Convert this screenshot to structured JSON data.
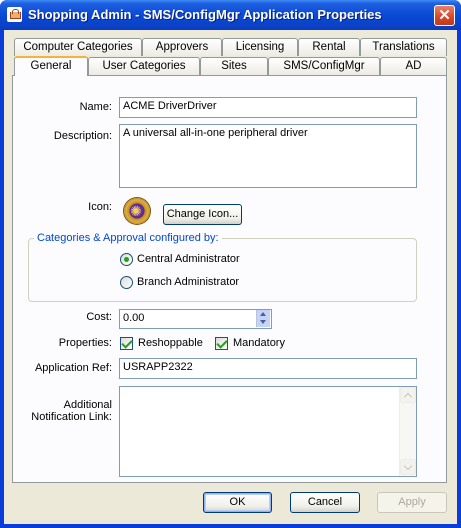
{
  "window": {
    "title": "Shopping Admin - SMS/ConfigMgr Application Properties",
    "close_label": "✕"
  },
  "tabs": {
    "row1": [
      "Computer Categories",
      "Approvers",
      "Licensing",
      "Rental",
      "Translations"
    ],
    "row2": [
      "General",
      "User Categories",
      "Sites",
      "SMS/ConfigMgr",
      "AD"
    ],
    "active": "General"
  },
  "form": {
    "name_label": "Name:",
    "name_value": "ACME DriverDriver",
    "description_label": "Description:",
    "description_value": "A universal all-in-one peripheral driver",
    "icon_label": "Icon:",
    "change_icon_button": "Change Icon...",
    "group_title": "Categories & Approval configured by:",
    "radio_central": "Central Administrator",
    "radio_branch": "Branch Administrator",
    "radio_selected": "Central Administrator",
    "cost_label": "Cost:",
    "cost_value": "0.00",
    "properties_label": "Properties:",
    "reshoppable_label": "Reshoppable",
    "reshoppable_checked": true,
    "mandatory_label": "Mandatory",
    "mandatory_checked": true,
    "app_ref_label": "Application Ref:",
    "app_ref_value": "USRAPP2322",
    "notification_label_1": "Additional",
    "notification_label_2": "Notification Link:",
    "notification_value": ""
  },
  "buttons": {
    "ok": "OK",
    "cancel": "Cancel",
    "apply": "Apply"
  },
  "colors": {
    "titlebar": "#0a4ad6",
    "dialog_bg": "#ece9d8",
    "group_title": "#0046d5",
    "check_mark": "#21a121"
  }
}
